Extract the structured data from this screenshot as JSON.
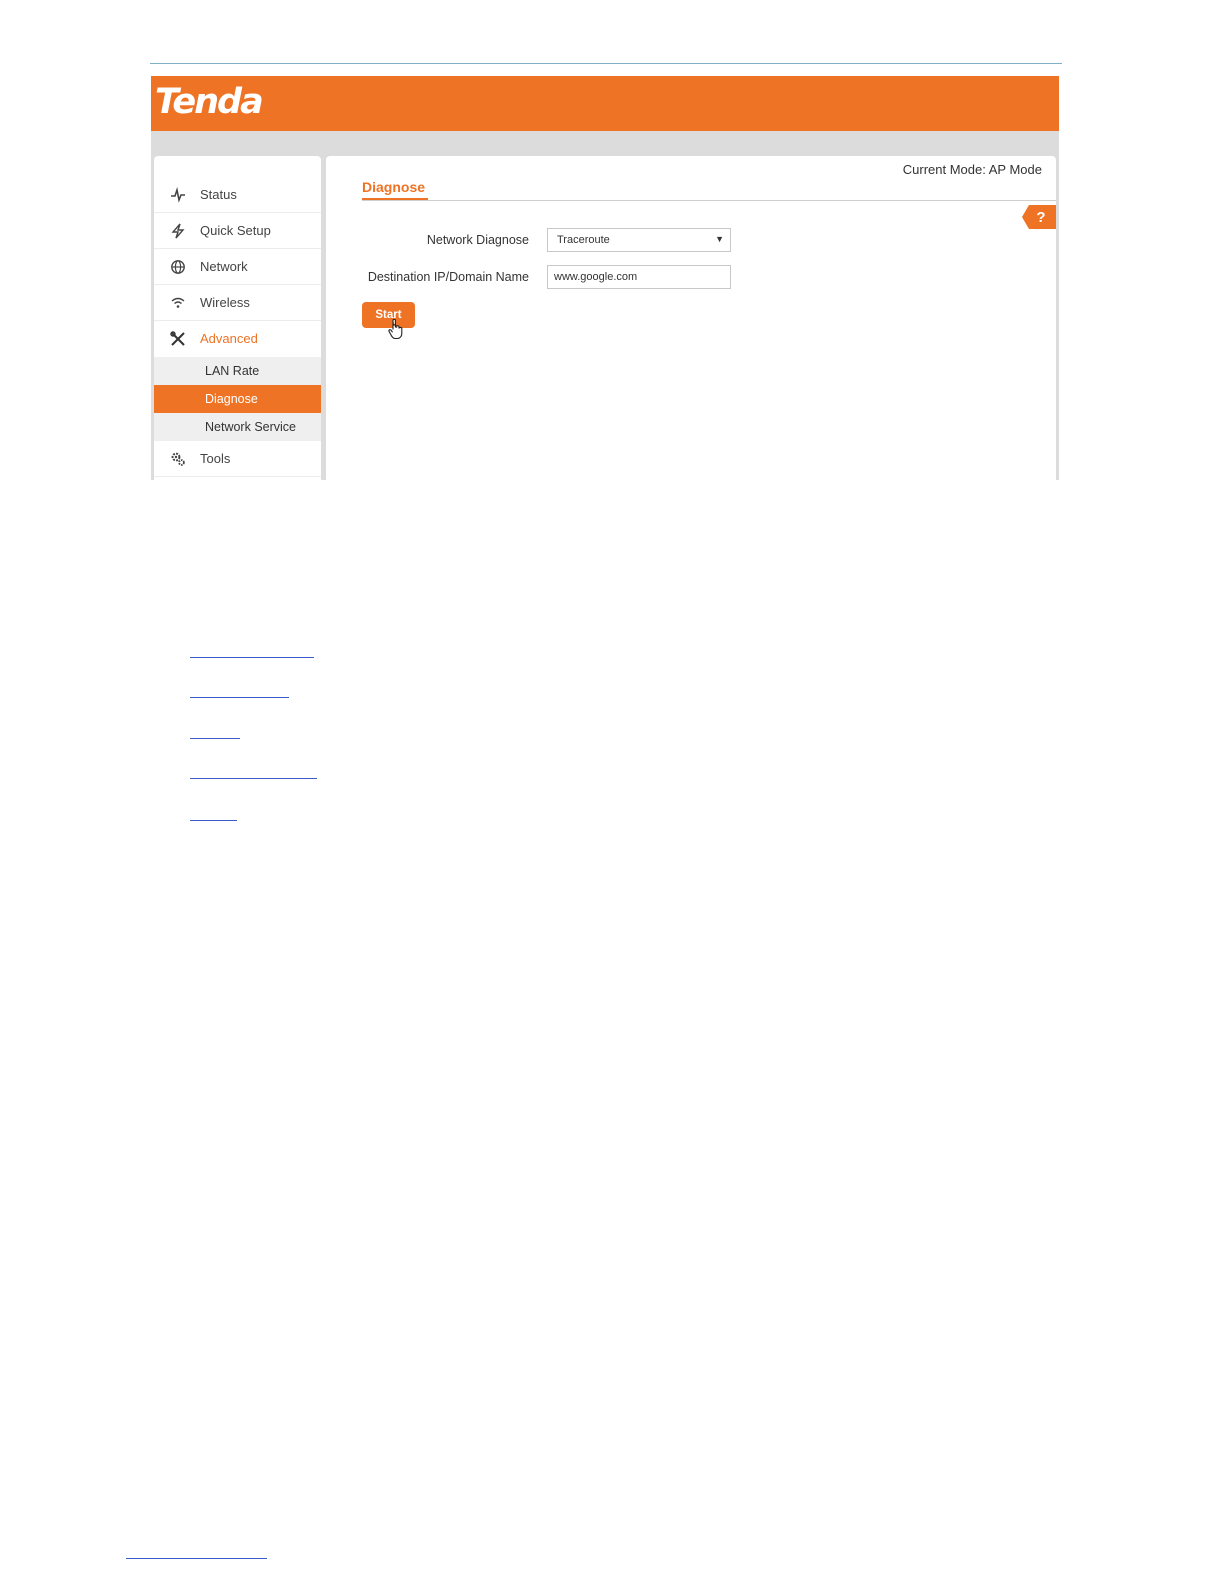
{
  "header": {
    "logo_text": "Tenda",
    "brand_color": "#ee7325"
  },
  "sidebar": {
    "items": [
      {
        "label": "Status",
        "icon": "pulse-icon"
      },
      {
        "label": "Quick Setup",
        "icon": "lightning-icon"
      },
      {
        "label": "Network",
        "icon": "globe-icon"
      },
      {
        "label": "Wireless",
        "icon": "wifi-icon"
      },
      {
        "label": "Advanced",
        "icon": "tools-icon",
        "expanded": true
      },
      {
        "label": "Tools",
        "icon": "gears-icon"
      }
    ],
    "advanced_subitems": [
      {
        "label": "LAN Rate",
        "active": false
      },
      {
        "label": "Diagnose",
        "active": true
      },
      {
        "label": "Network Service",
        "active": false
      }
    ]
  },
  "main": {
    "current_mode": "Current Mode: AP Mode",
    "title": "Diagnose",
    "help_label": "?",
    "form": {
      "network_diagnose_label": "Network Diagnose",
      "network_diagnose_value": "Traceroute",
      "destination_label": "Destination IP/Domain Name",
      "destination_value": "www.google.com",
      "start_label": "Start"
    }
  },
  "links": {
    "count": 6,
    "color": "#3b5bcc"
  }
}
